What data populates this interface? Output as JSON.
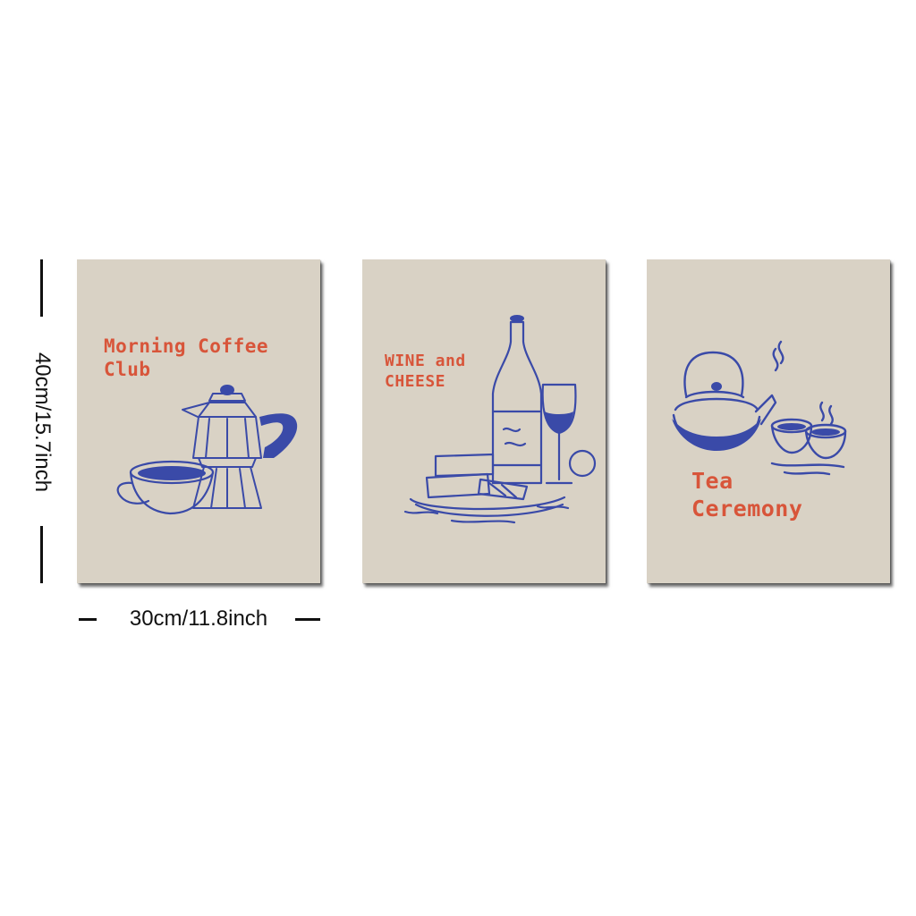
{
  "posters": [
    {
      "title_line1": "Morning Coffee",
      "title_line2": "Club",
      "illustration": "moka-pot-and-coffee-cup"
    },
    {
      "title_line1": "WINE and",
      "title_line2": "CHEESE",
      "illustration": "wine-bottle-glass-and-cheese-board"
    },
    {
      "title_line1": "Tea",
      "title_line2": "Ceremony",
      "illustration": "teapot-and-tea-cups"
    }
  ],
  "dimensions": {
    "height_label": "40cm/15.7inch",
    "width_label": "30cm/11.8inch"
  },
  "colors": {
    "poster_background": "#d9d2c5",
    "title_text": "#d8553a",
    "illustration_ink": "#3a4aa8",
    "page_background": "#ffffff"
  }
}
